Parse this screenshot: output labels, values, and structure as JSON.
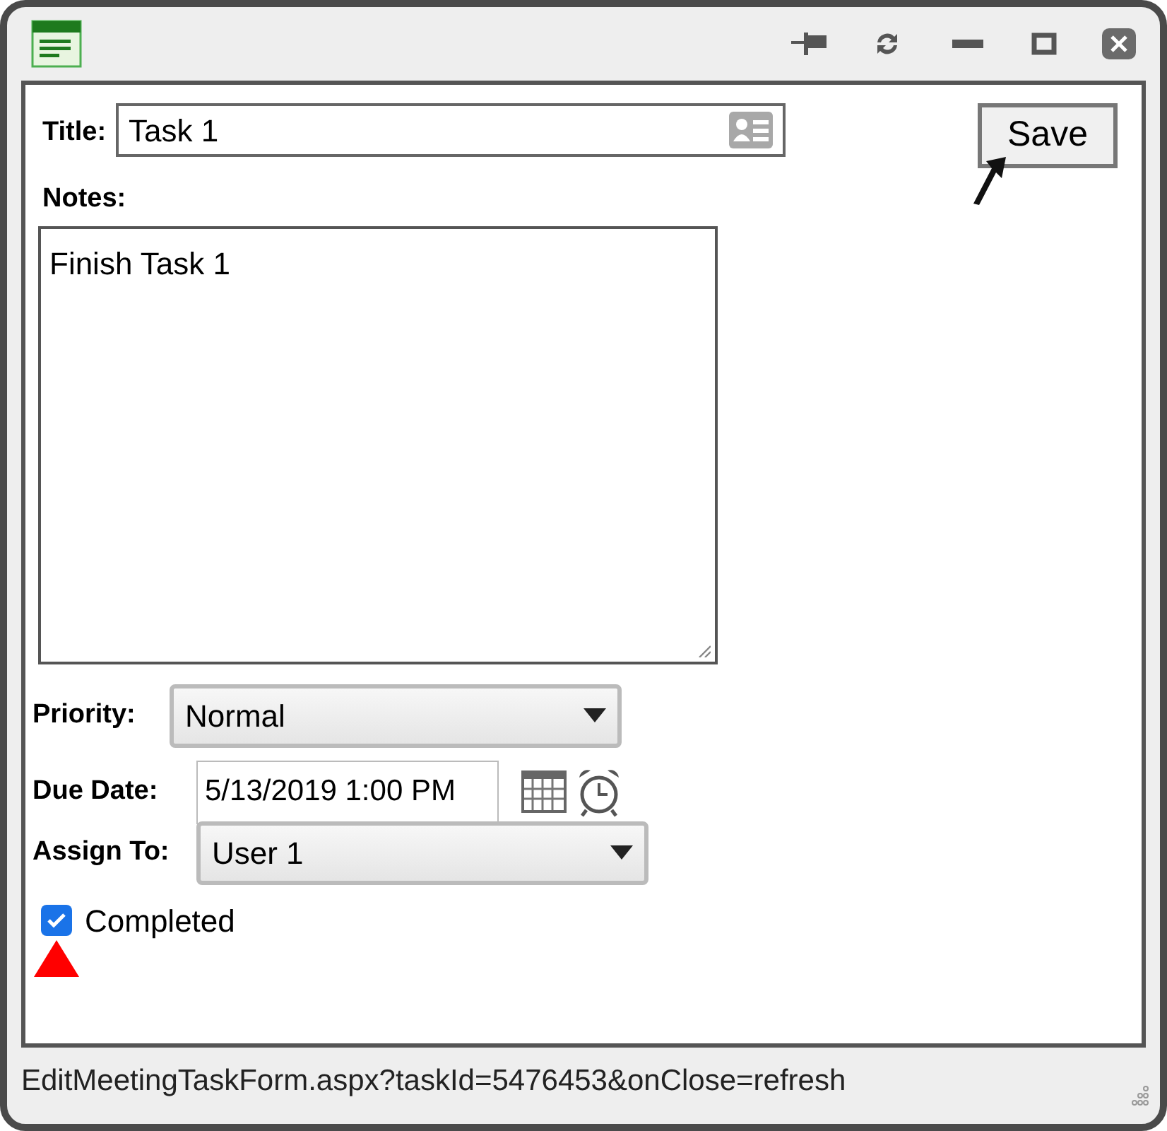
{
  "form": {
    "title": {
      "label": "Title:",
      "value": "Task 1"
    },
    "notes": {
      "label": "Notes:",
      "value": "Finish Task 1"
    },
    "priority": {
      "label": "Priority:",
      "value": "Normal"
    },
    "due_date": {
      "label": "Due Date:",
      "value": "5/13/2019 1:00 PM"
    },
    "assign_to": {
      "label": "Assign To:",
      "value": "User 1"
    },
    "completed": {
      "label": "Completed",
      "checked": true
    }
  },
  "save_button": "Save",
  "status_bar": "EditMeetingTaskForm.aspx?taskId=5476453&onClose=refresh"
}
